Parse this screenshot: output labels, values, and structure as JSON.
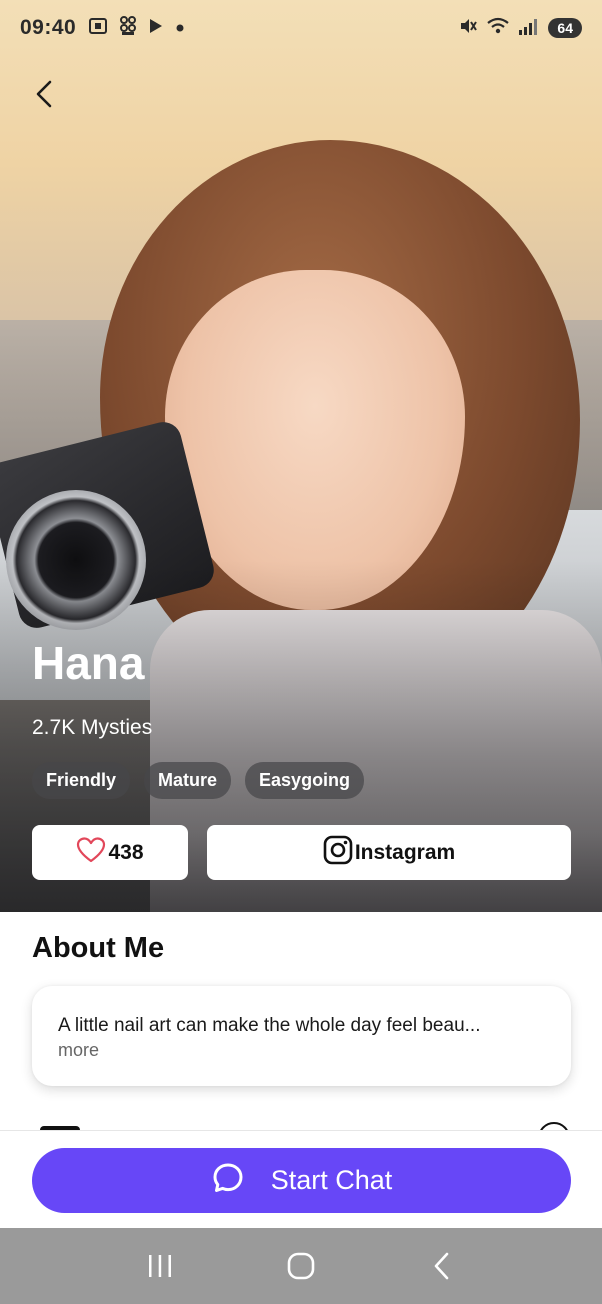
{
  "status_bar": {
    "time": "09:40",
    "left_icons": [
      "screenshot-icon",
      "qr-code-icon",
      "play-store-icon",
      "dot-icon"
    ],
    "right_icons": [
      "mute-icon",
      "wifi-icon",
      "signal-icon"
    ],
    "battery": "64"
  },
  "profile": {
    "name": "Hana",
    "followers": "2.7K Mysties",
    "tags": [
      "Friendly",
      "Mature",
      "Easygoing"
    ]
  },
  "actions": {
    "like_count": "438",
    "instagram_label": "Instagram"
  },
  "about": {
    "heading": "About Me",
    "text": "A little nail art can make the whole day feel beau...",
    "more": "more"
  },
  "bottom": {
    "start_chat_label": "Start Chat",
    "button_color": "#6747f7"
  },
  "nav": {
    "icons": [
      "recent-apps-icon",
      "home-icon",
      "back-icon"
    ]
  }
}
